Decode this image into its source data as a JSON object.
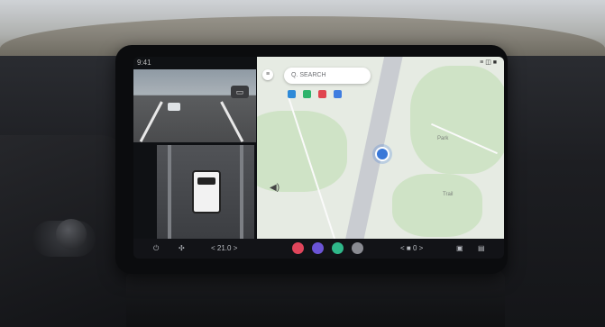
{
  "status_bar": {
    "left_text": "9:41",
    "right_text": "≡ ◫ ■"
  },
  "camera": {
    "front_badge": "▭"
  },
  "map": {
    "search_placeholder": "Q. SEARCH",
    "menu_icon": "menu-icon",
    "volume_icon": "speaker-icon",
    "place_labels": [
      "Park",
      "Trail"
    ],
    "chip_colors": [
      "#2e8ad8",
      "#2db36b",
      "#e0444e",
      "#3f7de0"
    ]
  },
  "taskbar": {
    "left_icons": [
      "power-icon",
      "fan-icon"
    ],
    "temp_left": "< 21.0 >",
    "temp_right": "< ■ 0 >",
    "apps": [
      {
        "name": "phone-app-icon",
        "color": "#e0455b"
      },
      {
        "name": "media-app-icon",
        "color": "#6b54d6"
      },
      {
        "name": "maps-app-icon",
        "color": "#2fb88a"
      },
      {
        "name": "settings-app-icon",
        "color": "#8a8b92"
      }
    ]
  }
}
